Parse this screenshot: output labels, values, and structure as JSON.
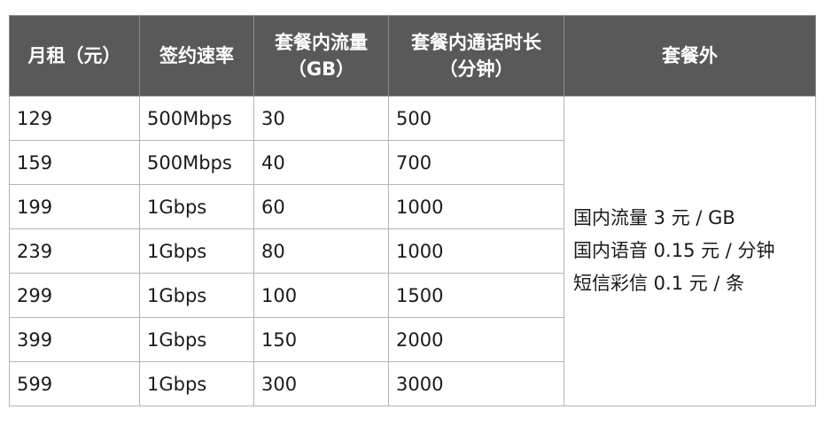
{
  "table": {
    "headers": [
      "月租（元）",
      "签约速率",
      "套餐内流量\n（GB）",
      "套餐内通话时长\n（分钟）",
      "套餐外"
    ],
    "rows": [
      [
        "129",
        "500Mbps",
        "30",
        "500"
      ],
      [
        "159",
        "500Mbps",
        "40",
        "700"
      ],
      [
        "199",
        "1Gbps",
        "60",
        "1000"
      ],
      [
        "239",
        "1Gbps",
        "80",
        "1000"
      ],
      [
        "299",
        "1Gbps",
        "100",
        "1500"
      ],
      [
        "399",
        "1Gbps",
        "150",
        "2000"
      ],
      [
        "599",
        "1Gbps",
        "300",
        "3000"
      ]
    ],
    "overage_lines": [
      "国内流量 3 元 / GB",
      "国内语音 0.15 元 / 分钟",
      "短信彩信 0.1 元 / 条"
    ]
  },
  "colors": {
    "header_background": "#595959",
    "header_text": "#ffffff",
    "grid": "#b5b5b5",
    "body_text": "#1a1a1a"
  }
}
